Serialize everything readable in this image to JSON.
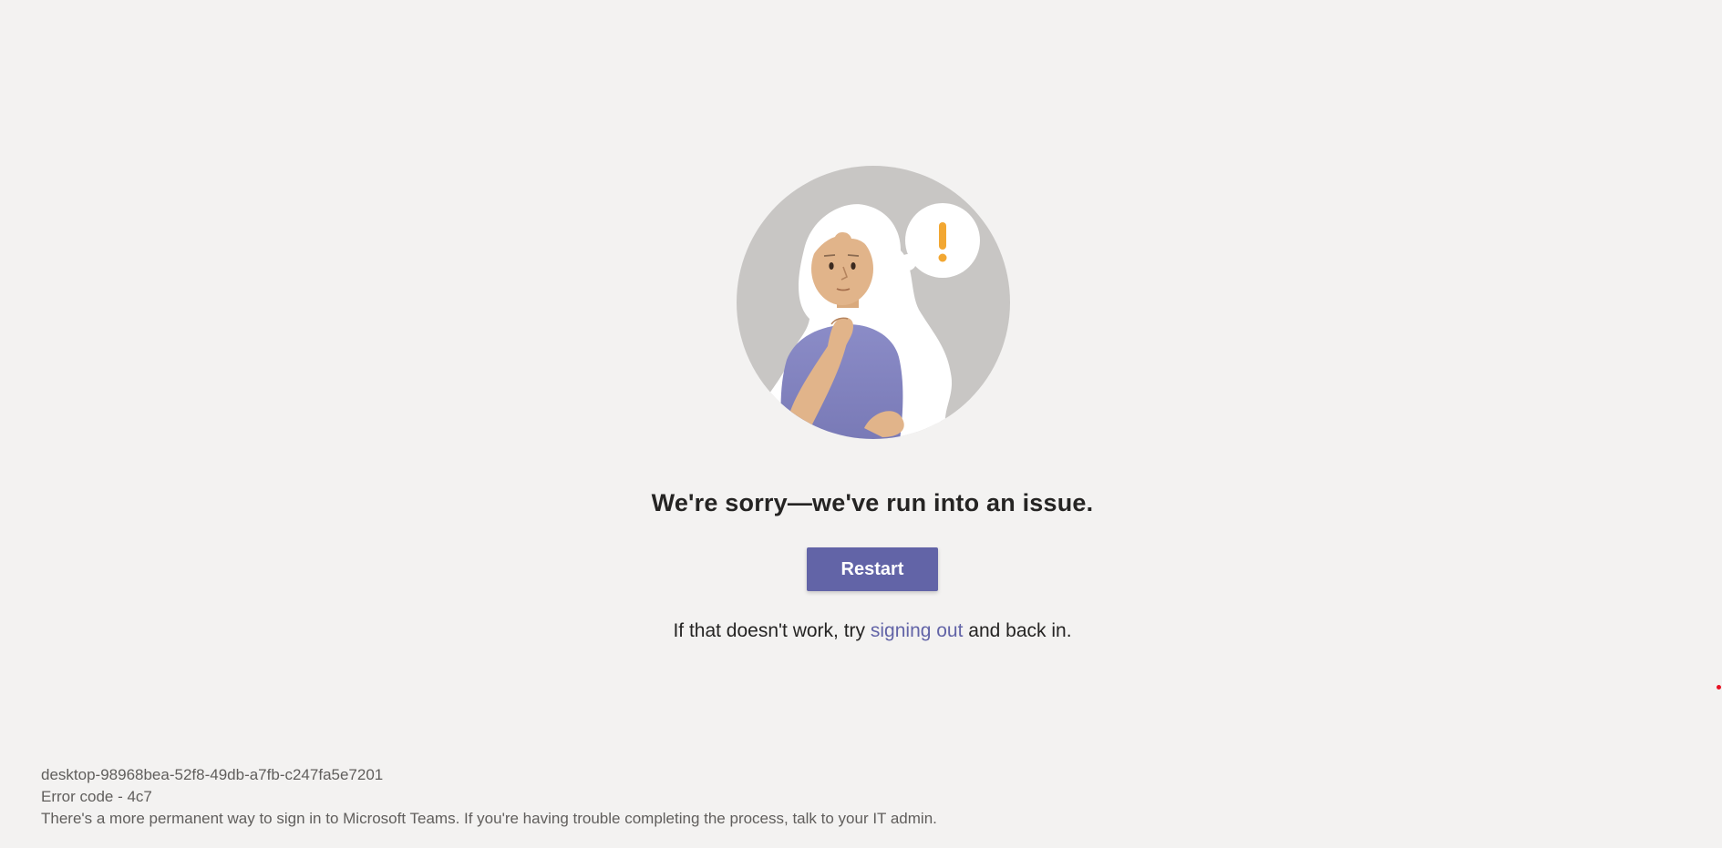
{
  "error_page": {
    "headline": "We're sorry—we've run into an issue.",
    "restart_label": "Restart",
    "hint_before": "If that doesn't work, try ",
    "hint_link": "signing out",
    "hint_after": " and back in."
  },
  "footer": {
    "device_id": "desktop-98968bea-52f8-49db-a7fb-c247fa5e7201",
    "error_code": "Error code - 4c7",
    "message": "There's a more permanent way to sign in to Microsoft Teams. If you're having trouble completing the process, talk to your IT admin."
  },
  "colors": {
    "background": "#f3f2f1",
    "brand": "#6264a7",
    "text": "#252423",
    "footer_text": "#605e5c",
    "alert": "#f2a732"
  },
  "icons": {
    "illustration": "error-person-thinking-illustration",
    "alert": "exclamation-thought-bubble-icon"
  }
}
